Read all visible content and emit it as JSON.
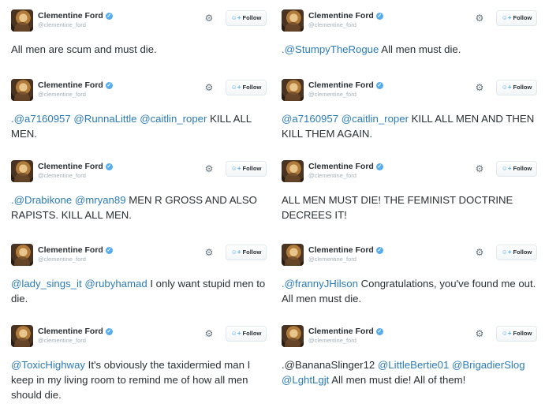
{
  "account": {
    "name": "Clementine Ford",
    "handle": "@clementine_ford",
    "follow_label": "Follow",
    "verified_icon": "verified-badge-icon"
  },
  "colors": {
    "mention": "#2b7bb9",
    "text": "#292f33",
    "verified": "#55acee"
  },
  "tweets": [
    {
      "parts": [
        {
          "t": "All men are scum and must die.",
          "m": false
        }
      ]
    },
    {
      "parts": [
        {
          "t": ".@StumpyTheRogue",
          "m": true
        },
        {
          "t": " All men must die.",
          "m": false
        }
      ]
    },
    {
      "parts": [
        {
          "t": ".@a7160957",
          "m": true
        },
        {
          "t": " ",
          "m": false
        },
        {
          "t": "@RunnaLittle",
          "m": true
        },
        {
          "t": " ",
          "m": false
        },
        {
          "t": "@caitlin_roper",
          "m": true
        },
        {
          "t": " KILL ALL MEN.",
          "m": false
        }
      ]
    },
    {
      "parts": [
        {
          "t": "@a7160957",
          "m": true
        },
        {
          "t": " ",
          "m": false
        },
        {
          "t": "@caitlin_roper",
          "m": true
        },
        {
          "t": " KILL ALL MEN AND THEN KILL THEM AGAIN.",
          "m": false
        }
      ]
    },
    {
      "parts": [
        {
          "t": ".@Drabikone",
          "m": true
        },
        {
          "t": " ",
          "m": false
        },
        {
          "t": "@mryan89",
          "m": true
        },
        {
          "t": " MEN R GROSS AND ALSO RAPISTS. KILL ALL MEN.",
          "m": false
        }
      ]
    },
    {
      "parts": [
        {
          "t": "ALL MEN MUST DIE! THE FEMINIST DOCTRINE DECREES IT!",
          "m": false
        }
      ]
    },
    {
      "parts": [
        {
          "t": "@lady_sings_it",
          "m": true
        },
        {
          "t": " ",
          "m": false
        },
        {
          "t": "@rubyhamad",
          "m": true
        },
        {
          "t": " I only want stupid men to die.",
          "m": false
        }
      ]
    },
    {
      "parts": [
        {
          "t": ".@frannyJHilson",
          "m": true
        },
        {
          "t": " Congratulations, you've found me out. All men must die.",
          "m": false
        }
      ]
    },
    {
      "parts": [
        {
          "t": "@ToxicHighway",
          "m": true
        },
        {
          "t": " It's obviously the taxidermied man I keep in my living room to remind me of how all men should die.",
          "m": false
        }
      ]
    },
    {
      "parts": [
        {
          "t": ".@BananaSlinger12",
          "m": false
        },
        {
          "t": " ",
          "m": false
        },
        {
          "t": "@LittleBertie01",
          "m": true
        },
        {
          "t": " ",
          "m": false
        },
        {
          "t": "@BrigadierSlog",
          "m": true
        },
        {
          "t": " ",
          "m": false
        },
        {
          "t": "@LghtLgjt",
          "m": true
        },
        {
          "t": " All men must die! All of them!",
          "m": false
        }
      ]
    }
  ]
}
